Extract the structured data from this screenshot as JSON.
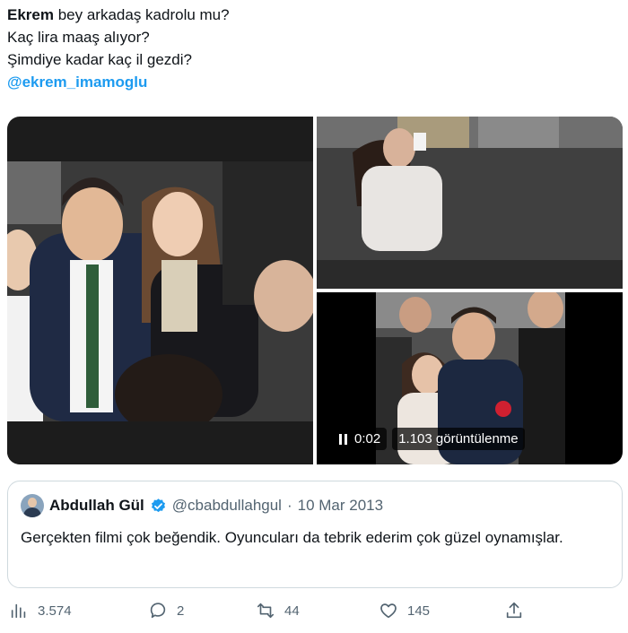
{
  "tweet": {
    "line1_bold": "Ekrem",
    "line1_rest": " bey arkadaş kadrolu mu?",
    "line2": "Kaç lira maaş alıyor?",
    "line3": "Şimdiye kadar kaç il gezdi?",
    "mention": "@ekrem_imamoglu"
  },
  "media": {
    "video": {
      "time": "0:02",
      "views": "1.103 görüntülenme"
    }
  },
  "quoted": {
    "name": "Abdullah Gül",
    "handle": "@cbabdullahgul",
    "separator": "·",
    "date": "10 Mar 2013",
    "text": "Gerçekten filmi çok beğendik. Oyuncuları da tebrik ederim çok güzel oynamışlar."
  },
  "stats": {
    "views": "3.574",
    "replies": "2",
    "retweets": "44",
    "likes": "145"
  },
  "colors": {
    "accent": "#1d9bf0",
    "muted": "#536471",
    "border": "#cfd9de"
  }
}
